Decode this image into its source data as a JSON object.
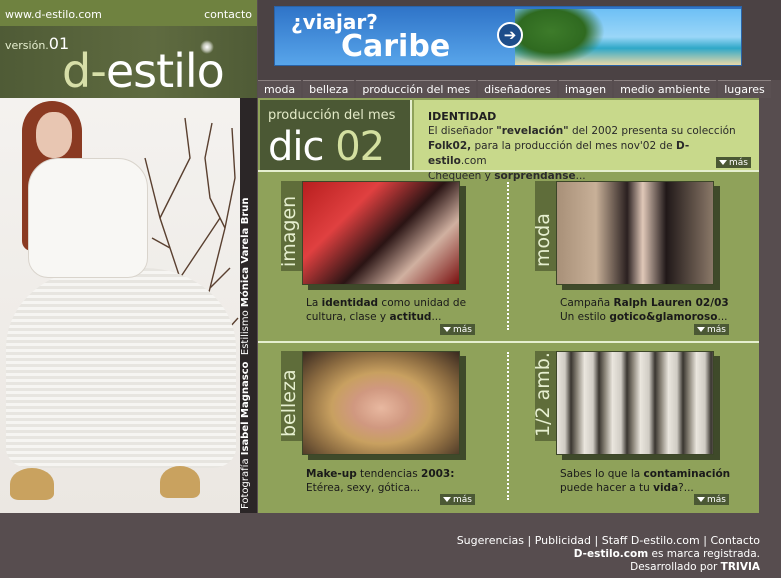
{
  "header": {
    "site_url": "www.d-estilo.com",
    "contact_link": "contacto",
    "version_label": "versión.",
    "version_number": "01",
    "logo_prefix": "d-",
    "logo_text": "estilo"
  },
  "banner": {
    "question": "¿viajar?",
    "destination": "Caribe"
  },
  "nav": {
    "items": [
      "moda",
      "belleza",
      "producción del mes",
      "diseñadores",
      "imagen",
      "medio ambiente",
      "lugares"
    ]
  },
  "photo_credit": {
    "photo_label": "Fotografía",
    "photographer": "Isabel Magnasco",
    "styling_label": "Estilismo",
    "stylist": "Mónica Varela Brun"
  },
  "feature": {
    "month_label": "producción del mes",
    "month_name": "dic",
    "month_number": "02",
    "title": "IDENTIDAD",
    "line1_a": "El diseñador ",
    "line1_b": "\"revelación\"",
    "line1_c": " del 2002 presenta su colección",
    "line2_a": "Folk02,",
    "line2_b": " para la producción del mes nov'02 de ",
    "line2_c": "D-estilo",
    "line2_d": ".com",
    "line3_a": "Chequeen y ",
    "line3_b": "sorprendanse",
    "line3_c": "...",
    "more": "más"
  },
  "cards": [
    {
      "tab": "imagen",
      "text_a": "La ",
      "text_b": "identidad",
      "text_c": " como unidad de",
      "text_d": "cultura, clase y ",
      "text_e": "actitud",
      "text_f": "...",
      "more": "más"
    },
    {
      "tab": "moda",
      "text_a": "Campaña ",
      "text_b": "Ralph Lauren 02/03",
      "text_c": "",
      "text_d": "Un estilo ",
      "text_e": "gotico&glamoroso",
      "text_f": "...",
      "more": "más"
    },
    {
      "tab": "belleza",
      "text_a": "",
      "text_b": "Make-up",
      "text_c": " tendencias ",
      "text_c2": "2003:",
      "text_d": "Etérea, sexy, gótica...",
      "more": "más"
    },
    {
      "tab": "1/2 amb.",
      "text_a": "Sabes lo que la ",
      "text_b": "contaminación",
      "text_d": "puede hacer a tu ",
      "text_e": "vida",
      "text_f": "?...",
      "more": "más"
    }
  ],
  "footer": {
    "links": [
      "Sugerencias",
      "Publicidad",
      "Staff D-estilo.com",
      "Contacto"
    ],
    "separator": " | ",
    "brand": "D-estilo.com",
    "registered": " es marca registrada.",
    "developed_by": "Desarrollado por ",
    "developer": "TRIVIA"
  }
}
